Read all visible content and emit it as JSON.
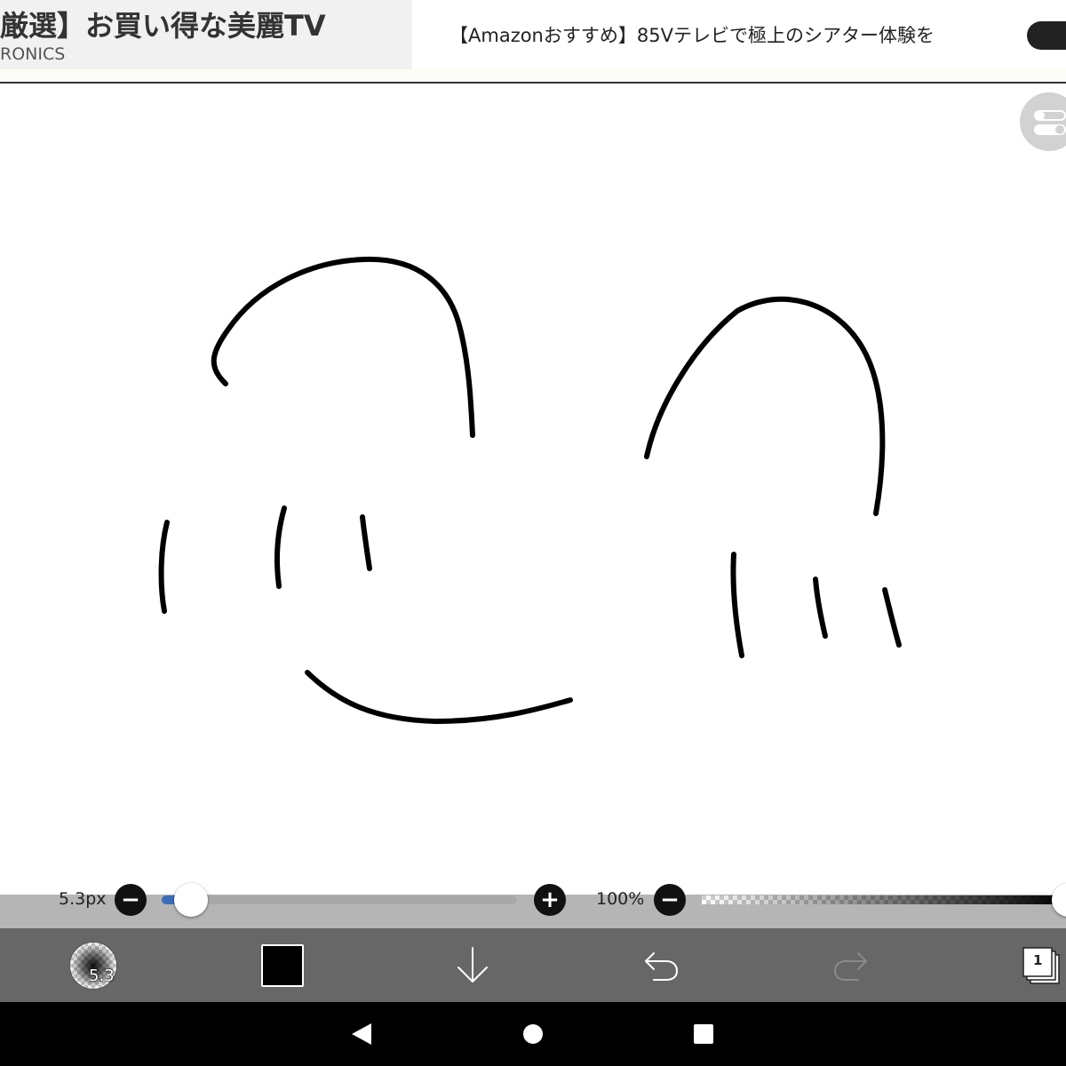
{
  "ad": {
    "left_title": "厳選】お買い得な美麗TV",
    "left_brand": "RONICS",
    "headline": "【Amazonおすすめ】85Vテレビで極上のシアター体験を"
  },
  "brush": {
    "size_label": "5.3px",
    "size_badge": "5.3",
    "size_level": 0.06
  },
  "opacity": {
    "label": "100%",
    "level": 1.0
  },
  "toolbar": {
    "color": "#000000",
    "layer_count": "1"
  },
  "icons": {
    "toggle": "layer-toggle-icon",
    "download": "arrow-down-icon",
    "undo": "undo-icon",
    "redo": "redo-icon",
    "layers": "layers-icon",
    "back": "back-triangle-icon",
    "home": "home-circle-icon",
    "recents": "recents-square-icon"
  },
  "colors": {
    "accent": "#3b6cb8",
    "toolbar_bg": "#676767",
    "stroke": "#000000"
  }
}
